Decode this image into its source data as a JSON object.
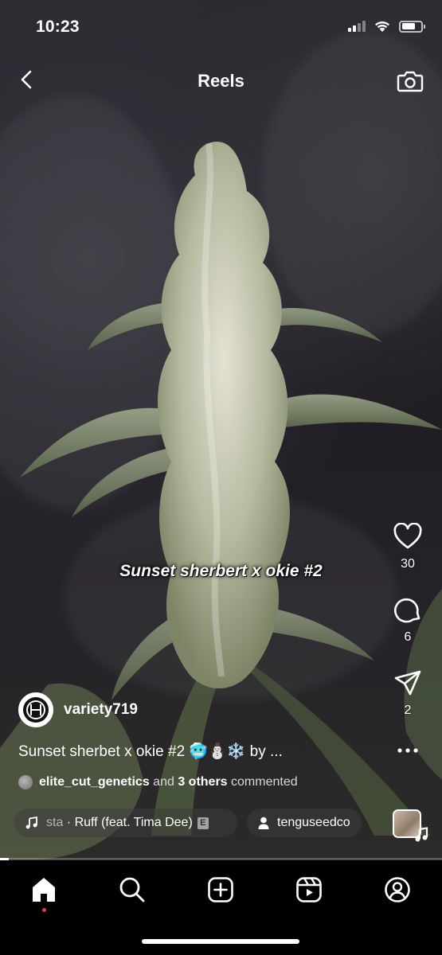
{
  "status_bar": {
    "time": "10:23"
  },
  "header": {
    "title": "Reels"
  },
  "video": {
    "overlay_text": "Sunset sherbert x okie #2"
  },
  "actions": {
    "likes": "30",
    "comments": "6",
    "shares": "2"
  },
  "post": {
    "username": "variety719",
    "caption": "Sunset sherbet x okie #2 🥶⛄️❄️ by ...",
    "comment_preview": {
      "user": "elite_cut_genetics",
      "middle": " and ",
      "others": "3 others",
      "suffix": " commented"
    },
    "audio": {
      "text_faded": "sta",
      "text": " · Ruff (feat. Tima Dee)",
      "explicit": "E"
    },
    "tagged_user": "tenguseedco"
  },
  "progress": {
    "value": 0.02
  },
  "colors": {
    "notification_dot": "#ff3040",
    "background": "#000000"
  },
  "icons": [
    "back-icon",
    "camera-icon",
    "heart-icon",
    "comment-icon",
    "share-icon",
    "more-icon",
    "music-note-icon",
    "person-icon",
    "home-icon",
    "search-icon",
    "create-icon",
    "reels-icon",
    "profile-icon"
  ]
}
